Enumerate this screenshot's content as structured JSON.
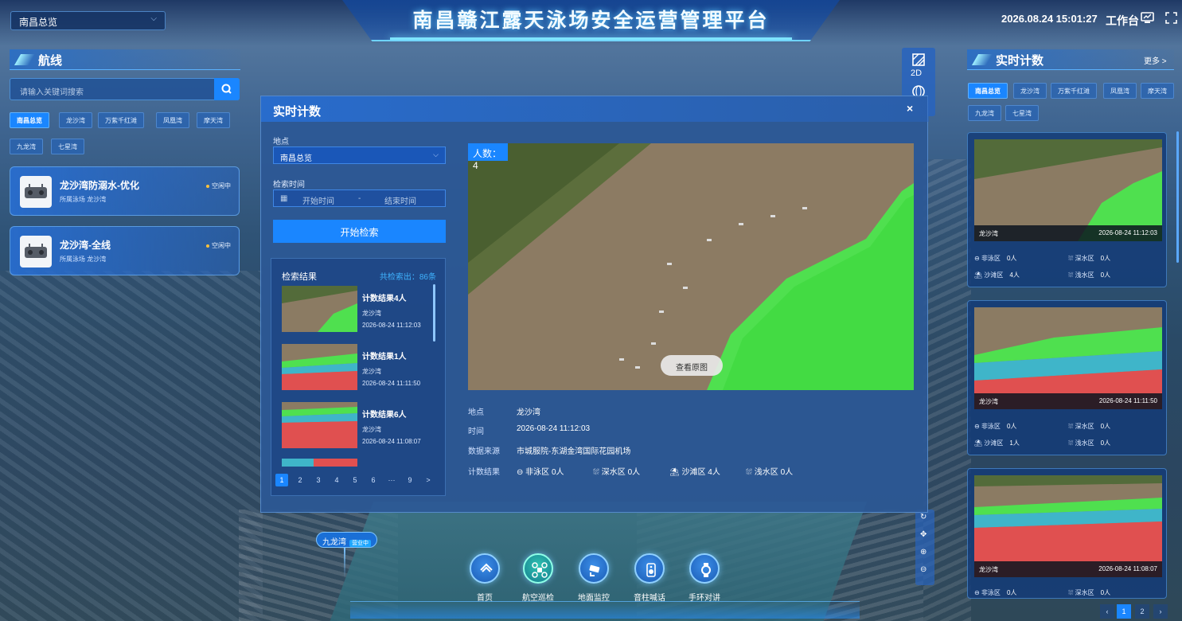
{
  "header": {
    "title": "南昌赣江露天泳场安全运营管理平台",
    "region_select": "南昌总览",
    "datetime": "2026.08.24 15:01:27",
    "workbench": "工作台"
  },
  "left_panel": {
    "section_title": "航线",
    "search_placeholder": "请输入关键词搜索",
    "tags": [
      "南昌总览",
      "龙沙湾",
      "万紫千红滩",
      "凤凰湾",
      "摩天湾",
      "九龙湾",
      "七星湾"
    ],
    "active_tag": "南昌总览",
    "routes": [
      {
        "name": "龙沙湾防溺水-优化",
        "venue": "所属泳场  龙沙湾",
        "status": "空闲中"
      },
      {
        "name": "龙沙湾-全线",
        "venue": "所属泳场  龙沙湾",
        "status": "空闲中"
      }
    ]
  },
  "right_panel": {
    "section_title": "实时计数",
    "more": "更多 >",
    "tags": [
      "南昌总览",
      "龙沙湾",
      "万紫千红滩",
      "凤凰湾",
      "摩天湾",
      "九龙湾",
      "七星湾"
    ],
    "cards": [
      {
        "loc": "龙沙湾",
        "time": "2026-08-24 11:12:03",
        "stats": [
          "非泳区",
          "0人",
          "深水区",
          "0人",
          "沙滩区",
          "4人",
          "浅水区",
          "0人"
        ]
      },
      {
        "loc": "龙沙湾",
        "time": "2026-08-24 11:11:50",
        "stats": [
          "非泳区",
          "0人",
          "深水区",
          "0人",
          "沙滩区",
          "1人",
          "浅水区",
          "0人"
        ]
      },
      {
        "loc": "龙沙湾",
        "time": "2026-08-24 11:08:07",
        "stats": [
          "非泳区",
          "0人",
          "深水区",
          "0人"
        ]
      }
    ],
    "pages": [
      "1",
      "2"
    ]
  },
  "map_tools": {
    "mode": "2D"
  },
  "modal": {
    "title": "实时计数",
    "close": "×",
    "location_label": "地点",
    "location_value": "南昌总览",
    "time_label": "检索时间",
    "start_placeholder": "开始时间",
    "end_placeholder": "结束时间",
    "date_sep": "-",
    "search_button": "开始检索",
    "results_label": "检索结果",
    "results_count": "共检索出：86条",
    "results": [
      {
        "title": "计数结果4人",
        "loc": "龙沙湾",
        "time": "2026-08-24 11:12:03"
      },
      {
        "title": "计数结果1人",
        "loc": "龙沙湾",
        "time": "2026-08-24 11:11:50"
      },
      {
        "title": "计数结果6人",
        "loc": "龙沙湾",
        "time": "2026-08-24 11:08:07"
      }
    ],
    "pagination": [
      "1",
      "2",
      "3",
      "4",
      "5",
      "6",
      "···",
      "9",
      ">"
    ],
    "count_badge": "人数：4",
    "view_original": "查看原图",
    "info": {
      "loc_label": "地点",
      "loc": "龙沙湾",
      "time_label": "时间",
      "time": "2026-08-24 11:12:03",
      "source_label": "数据来源",
      "source": "市城服院-东湖金湾国际花园机场",
      "result_label": "计数结果",
      "stats": [
        "非泳区",
        "0人",
        "深水区",
        "0人",
        "沙滩区",
        "4人",
        "浅水区",
        "0人"
      ]
    }
  },
  "map_pin": {
    "name": "九龙湾",
    "badge": "营业中"
  },
  "dock": [
    "首页",
    "航空巡检",
    "地面监控",
    "音柱喊话",
    "手环对讲"
  ]
}
